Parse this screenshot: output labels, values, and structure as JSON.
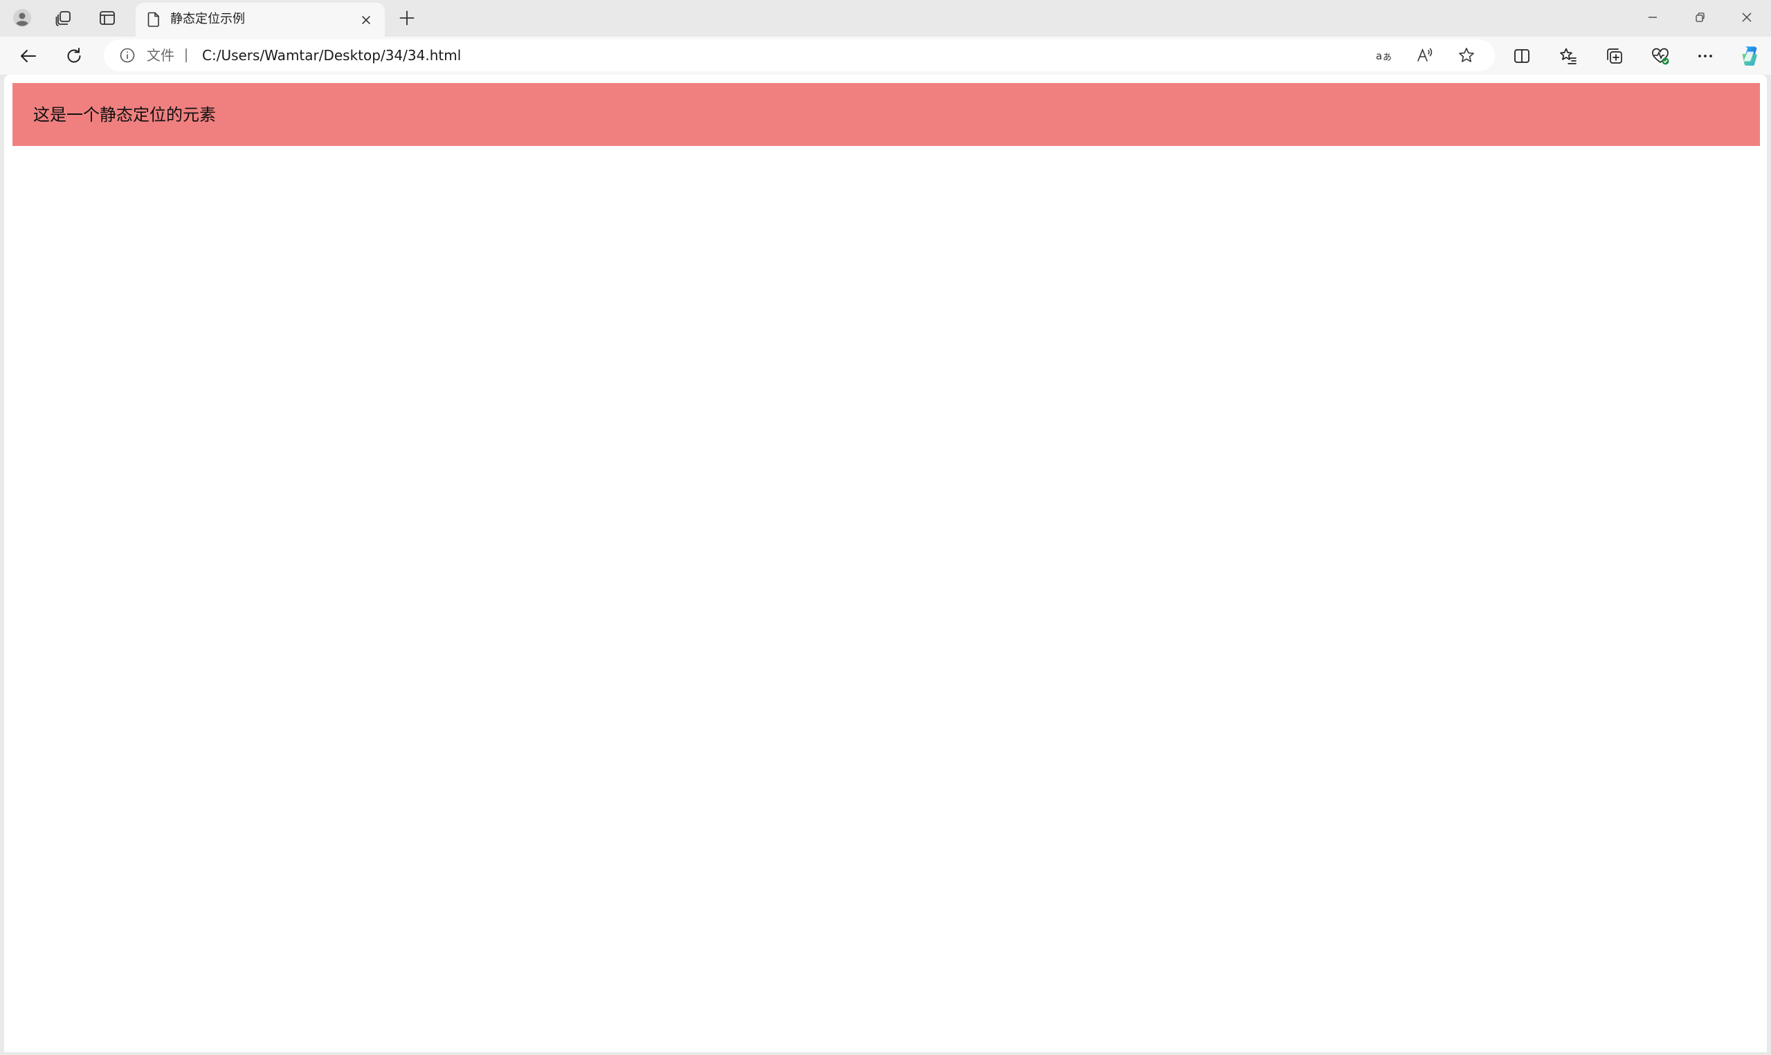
{
  "browser": {
    "tab": {
      "title": "静态定位示例"
    },
    "address_bar": {
      "scheme_label": "文件",
      "url": "C:/Users/Wamtar/Desktop/34/34.html"
    },
    "icons": {
      "profile": "profile-icon",
      "workspaces": "workspaces-icon",
      "vertical_tabs": "vertical-tabs-icon",
      "tab_favicon": "document-icon",
      "tab_close": "close-icon",
      "new_tab": "plus-icon",
      "minimize": "minimize-icon",
      "restore": "restore-icon",
      "close_window": "close-icon",
      "back": "back-arrow-icon",
      "refresh": "refresh-icon",
      "site_info": "info-icon",
      "translate": "translate-icon",
      "read_aloud": "read-aloud-icon",
      "favorite": "star-icon",
      "split_screen": "split-screen-icon",
      "favorites": "favorites-list-icon",
      "collections": "collections-icon",
      "browser_essentials": "heart-pulse-icon",
      "more": "more-dots-icon",
      "copilot": "copilot-icon"
    }
  },
  "page": {
    "static_element_text": "这是一个静态定位的元素",
    "static_element_color": "#f08080"
  },
  "colors": {
    "chrome_background": "#e9e9e9",
    "toolbar_background": "#f7f7f7",
    "page_background": "#ffffff"
  }
}
